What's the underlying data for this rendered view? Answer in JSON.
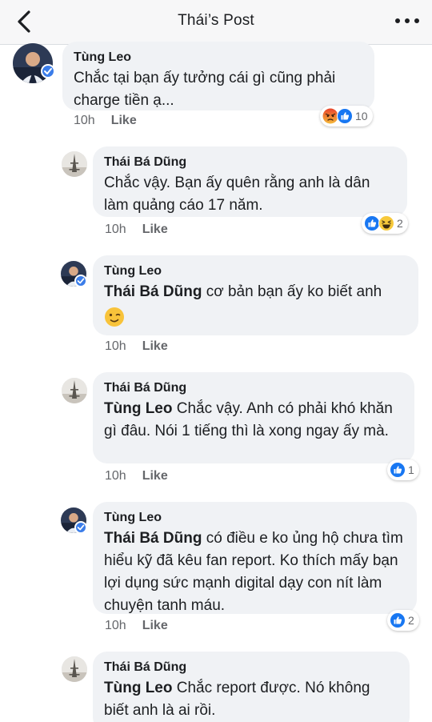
{
  "header": {
    "title": "Thái’s Post"
  },
  "comments": [
    {
      "author": "Tùng Leo",
      "text": "Chắc tại bạn ấy tưởng cái gì cũng phải charge tiền ạ...",
      "time": "10h",
      "like_label": "Like",
      "reaction_count": "10",
      "reaction_icons": [
        "angry-reaction-icon",
        "like-reaction-icon"
      ]
    },
    {
      "author": "Thái Bá Dũng",
      "text": "Chắc vậy. Bạn ấy quên rằng anh là dân làm quảng cáo 17 năm.",
      "time": "10h",
      "like_label": "Like",
      "reaction_count": "2",
      "reaction_icons": [
        "like-reaction-icon",
        "haha-reaction-icon"
      ]
    },
    {
      "author": "Tùng Leo",
      "mention": "Thái Bá Dũng",
      "text": " cơ bản bạn ấy ko biết anh",
      "trailing_emoji": "winking-face-icon",
      "time": "10h",
      "like_label": "Like"
    },
    {
      "author": "Thái Bá Dũng",
      "mention": "Tùng Leo",
      "text": " Chắc vậy. Anh có phải khó khăn gì đâu. Nói 1 tiếng thì là xong ngay ấy mà.",
      "time": "10h",
      "like_label": "Like",
      "reaction_count": "1",
      "reaction_icons": [
        "like-reaction-icon"
      ]
    },
    {
      "author": "Tùng Leo",
      "mention": "Thái Bá Dũng",
      "text": "  có điều e ko ủng hộ chưa tìm hiểu kỹ đã kêu fan report. Ko thích mấy bạn lợi dụng sức mạnh digital dạy con nít làm chuyện tanh máu.",
      "time": "10h",
      "like_label": "Like",
      "reaction_count": "2",
      "reaction_icons": [
        "like-reaction-icon"
      ]
    },
    {
      "author": "Thái Bá Dũng",
      "mention": "Tùng Leo",
      "text": " Chắc report được. Nó không biết anh là ai rồi."
    }
  ],
  "colors": {
    "bubble": "#f0f2f5",
    "like_blue": "#1877f2",
    "verified": "#3b7de9",
    "meta": "#65676b"
  }
}
